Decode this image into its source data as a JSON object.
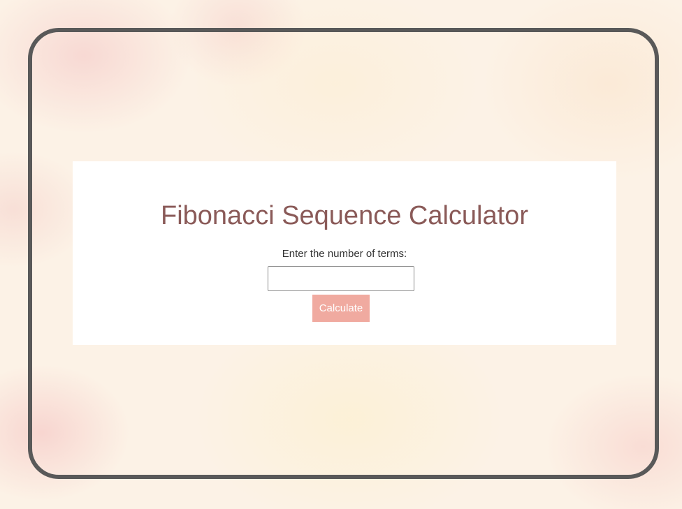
{
  "calculator": {
    "title": "Fibonacci Sequence Calculator",
    "input_label": "Enter the number of terms:",
    "input_value": "",
    "input_placeholder": "",
    "button_label": "Calculate"
  },
  "colors": {
    "title": "#8a5a58",
    "button_background": "#f0aaa0",
    "button_text": "#ffffff",
    "frame_border": "#595959",
    "card_background": "#ffffff"
  }
}
